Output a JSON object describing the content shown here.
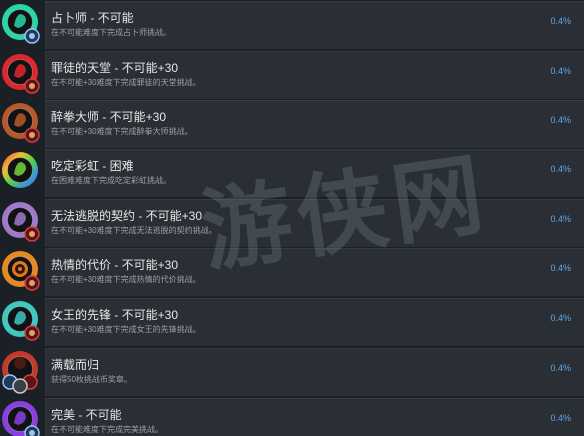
{
  "achievements": [
    {
      "title": "占卜师 - 不可能",
      "desc": "在不可能难度下完成占卜师挑战。",
      "percent": "0.4%",
      "icon": "fortune-teller-icon",
      "color": "#2bd6a6",
      "badge": "blue-medal"
    },
    {
      "title": "罪徒的天堂 - 不可能+30",
      "desc": "在不可能+30难度下完成罪徒的天堂挑战。",
      "percent": "0.4%",
      "icon": "sinners-paradise-icon",
      "color": "#e0262e",
      "badge": "red-medal"
    },
    {
      "title": "醉拳大师 - 不可能+30",
      "desc": "在不可能+30难度下完成醉拳大师挑战。",
      "percent": "0.4%",
      "icon": "drunken-master-icon",
      "color": "#b65a2c",
      "badge": "red-medal"
    },
    {
      "title": "吃定彩虹 - 困难",
      "desc": "在困难难度下完成吃定彩虹挑战。",
      "percent": "0.4%",
      "icon": "rainbow-icon",
      "color": "#7ad13c",
      "badge": "none"
    },
    {
      "title": "无法逃脱的契约 - 不可能+30",
      "desc": "在不可能+30难度下完成无法逃脱的契约挑战。",
      "percent": "0.4%",
      "icon": "contract-icon",
      "color": "#a07ac8",
      "badge": "red-medal"
    },
    {
      "title": "热情的代价 - 不可能+30",
      "desc": "在不可能+30难度下完成热情的代价挑战。",
      "percent": "0.4%",
      "icon": "passion-price-icon",
      "color": "#e58a20",
      "badge": "red-medal"
    },
    {
      "title": "女王的先锋 - 不可能+30",
      "desc": "在不可能+30难度下完成女王的先锋挑战。",
      "percent": "0.4%",
      "icon": "queens-vanguard-icon",
      "color": "#3ec8c0",
      "badge": "red-medal"
    },
    {
      "title": "满载而归",
      "desc": "获得50枚挑战币奖章。",
      "percent": "0.4%",
      "icon": "medals-icon",
      "color": "#c23a2a",
      "badge": "multi"
    },
    {
      "title": "完美 - 不可能",
      "desc": "在不可能难度下完成完美挑战。",
      "percent": "0.4%",
      "icon": "perfect-icon",
      "color": "#8a40e0",
      "badge": "blue-medal"
    }
  ],
  "watermark": "游侠网"
}
